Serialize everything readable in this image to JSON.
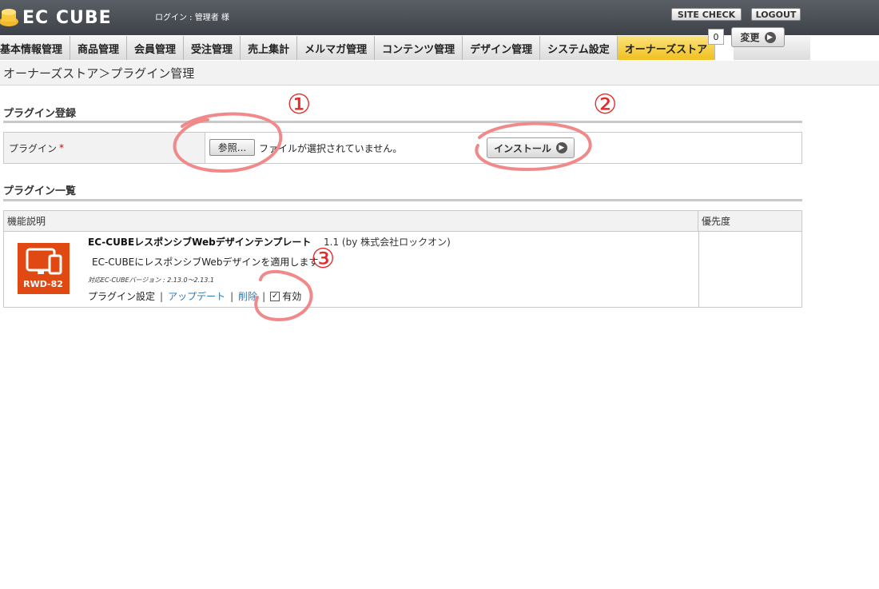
{
  "header": {
    "logo_text": "EC CUBE",
    "login_label": "ログイン : 管理者 様",
    "site_check_label": "SITE CHECK",
    "logout_label": "LOGOUT"
  },
  "nav": {
    "items": [
      "基本情報管理",
      "商品管理",
      "会員管理",
      "受注管理",
      "売上集計",
      "メルマガ管理",
      "コンテンツ管理",
      "デザイン管理",
      "システム設定",
      "オーナーズストア"
    ],
    "active": "オーナーズストア"
  },
  "page": {
    "breadcrumb": "オーナーズストア＞プラグイン管理"
  },
  "register": {
    "section_title": "プラグイン登録",
    "field_label": "プラグイン",
    "required_mark": "*",
    "browse_label": "参照...",
    "file_status": "ファイルが選択されていません。",
    "install_label": "インストール"
  },
  "list": {
    "section_title": "プラグイン一覧",
    "header_desc": "機能説明",
    "header_priority": "優先度",
    "plugins": [
      {
        "name": "EC-CUBEレスポンシブWebデザインテンプレート",
        "version": "1.1 (by 株式会社ロックオン)",
        "description": "EC-CUBEにレスポンシブWebデザインを適用します",
        "compat": "対応EC-CUBEバージョン : 2.13.0〜2.13.1",
        "thumb_text": "RWD-82",
        "settings_label": "プラグイン設定",
        "update_label": "アップデート",
        "delete_label": "削除",
        "enabled_label": "有効",
        "enabled": true,
        "priority": "0",
        "change_label": "変更"
      }
    ]
  },
  "annotations": {
    "marks": [
      "①",
      "②",
      "③"
    ],
    "color": "#e62a2a",
    "circle_color": "#f08a8a"
  }
}
